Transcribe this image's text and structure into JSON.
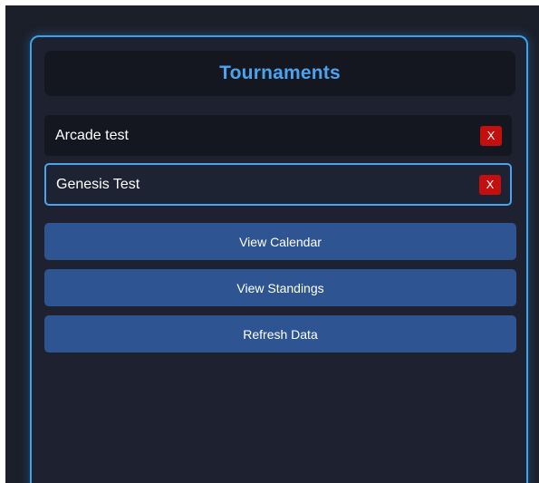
{
  "panel": {
    "title": "Tournaments"
  },
  "tournaments": [
    {
      "label": "Arcade test",
      "delete_label": "X",
      "selected": false
    },
    {
      "label": "Genesis Test",
      "delete_label": "X",
      "selected": true
    }
  ],
  "actions": {
    "view_calendar": "View Calendar",
    "view_standings": "View Standings",
    "refresh_data": "Refresh Data"
  },
  "colors": {
    "accent": "#4aa3ee",
    "panel_border": "#3aa2ee",
    "button_bg": "#2e5592",
    "delete_bg": "#c40f0f",
    "background": "#1b1f2a"
  }
}
